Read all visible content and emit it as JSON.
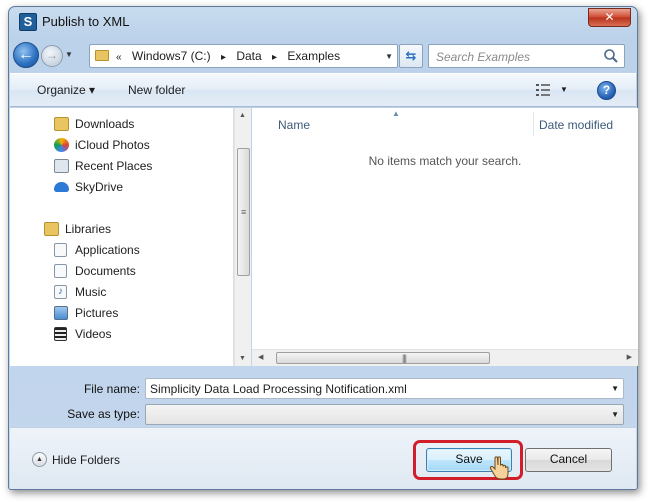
{
  "window": {
    "title": "Publish to XML",
    "app_icon_letter": "S",
    "close_label": "✕"
  },
  "navigation": {
    "breadcrumb_prefix": "«",
    "breadcrumbs": [
      "Windows7 (C:)",
      "Data",
      "Examples"
    ],
    "search_placeholder": "Search Examples"
  },
  "toolbar": {
    "organize_label": "Organize ▾",
    "new_folder_label": "New folder",
    "help_label": "?"
  },
  "sidebar": {
    "items": [
      {
        "label": "Downloads",
        "icon": "downloads-icon"
      },
      {
        "label": "iCloud Photos",
        "icon": "icloud-photos-icon"
      },
      {
        "label": "Recent Places",
        "icon": "recent-places-icon"
      },
      {
        "label": "SkyDrive",
        "icon": "skydrive-icon"
      },
      {
        "label": "Libraries",
        "icon": "libraries-icon"
      },
      {
        "label": "Applications",
        "icon": "document-library-icon"
      },
      {
        "label": "Documents",
        "icon": "document-library-icon"
      },
      {
        "label": "Music",
        "icon": "music-library-icon"
      },
      {
        "label": "Pictures",
        "icon": "pictures-library-icon"
      },
      {
        "label": "Videos",
        "icon": "videos-library-icon"
      }
    ]
  },
  "file_list": {
    "columns": [
      "Name",
      "Date modified"
    ],
    "empty_message": "No items match your search."
  },
  "form": {
    "file_name_label": "File name:",
    "file_name_value": "Simplicity Data Load Processing Notification.xml",
    "save_type_label": "Save as type:",
    "save_type_value": ""
  },
  "footer": {
    "hide_folders_label": "Hide Folders",
    "save_label": "Save",
    "cancel_label": "Cancel"
  },
  "colors": {
    "highlight": "#d21d2a",
    "title_bar": "#bcd2ea",
    "accent_blue": "#2a6fc0"
  }
}
